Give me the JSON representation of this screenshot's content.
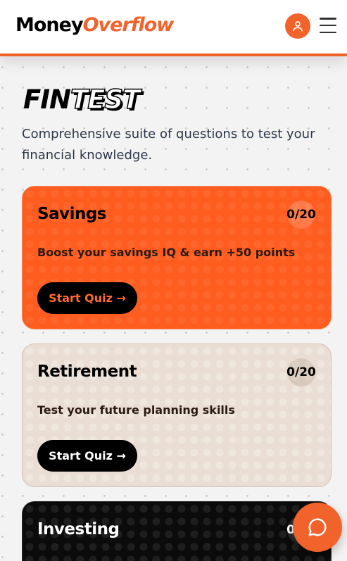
{
  "header": {
    "logo_main": "Money",
    "logo_accent": "Overflow",
    "user_icon": "user-icon",
    "menu_icon": "hamburger-menu-icon"
  },
  "hero": {
    "title_solid": "FIN",
    "title_outline": "TEST",
    "description": "Comprehensive suite of questions to test your financial knowledge."
  },
  "quizzes": [
    {
      "title": "Savings",
      "score": "0/20",
      "description": "Boost your savings IQ & earn +50 points",
      "button_label": "Start Quiz →",
      "color": "#ff5c1f"
    },
    {
      "title": "Retirement",
      "score": "0/20",
      "description": "Test your future planning skills",
      "button_label": "Start Quiz →",
      "color": "#eaddd3"
    },
    {
      "title": "Investing",
      "score": "0/20",
      "color": "#0b0b0b"
    }
  ],
  "chat": {
    "icon": "chat-bubble-icon"
  },
  "colors": {
    "accent": "#f2622b",
    "text_dark": "#2d3748"
  }
}
